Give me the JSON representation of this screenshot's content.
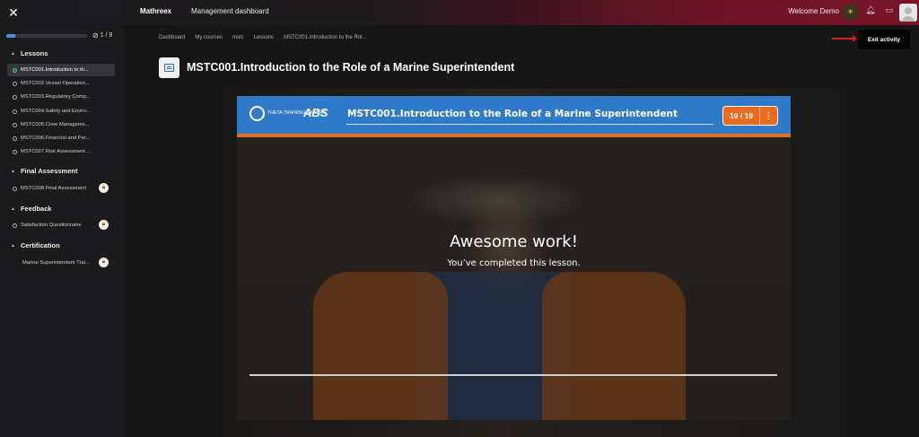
{
  "topbar": {
    "brand": "Mathreex",
    "nav_link": "Management dashboard",
    "welcome": "Welcome Demo"
  },
  "sidebar": {
    "progress_fraction": 0.11,
    "progress_text": "1 / 9",
    "sections": [
      {
        "title": "Lessons",
        "items": [
          {
            "label": "MSTC001.Introduction to th...",
            "active": true
          },
          {
            "label": "MSTC002.Vessel Operation..."
          },
          {
            "label": "MSTC003.Regulatory Comp..."
          },
          {
            "label": "MSTC004.Safety and Enviro..."
          },
          {
            "label": "MSTC005.Crew Manageme..."
          },
          {
            "label": "MSTC006.Financial and Per..."
          },
          {
            "label": "MSTC007.Risk Assessment ..."
          }
        ]
      },
      {
        "title": "Final Assessment",
        "items": [
          {
            "label": "MSTC008.Final Assessment",
            "locked": true
          }
        ]
      },
      {
        "title": "Feedback",
        "items": [
          {
            "label": "Satisfaction Questionnaire",
            "locked": true
          }
        ]
      },
      {
        "title": "Certification",
        "items": [
          {
            "label": "Marine Superintendent Trai...",
            "locked": true
          }
        ]
      }
    ]
  },
  "breadcrumb": [
    "Dashboard",
    "My courses",
    "mstc",
    "Lessons",
    "MSTC001.Introduction to the Rol..."
  ],
  "page_title": "MSTC001.Introduction to the Role of a Marine Superintendent",
  "exit_label": "Exit activity",
  "player": {
    "logo_text": "THETA TRAINING CENTER",
    "abs_logo": "ABS",
    "title": "MSTC001.Introduction to the Role of a Marine Superintendent",
    "counter": "19 / 19",
    "message_title": "Awesome work!",
    "message_sub": "You’ve completed this lesson."
  }
}
